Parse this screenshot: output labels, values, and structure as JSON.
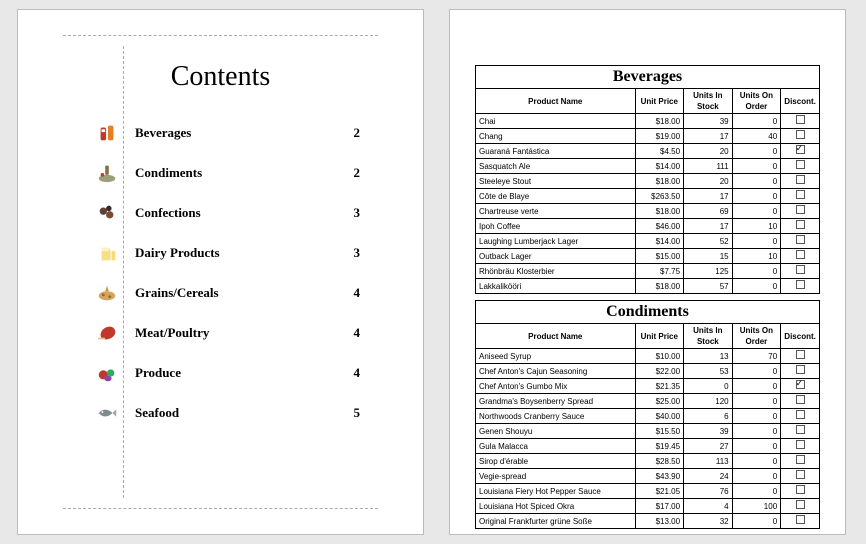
{
  "contents": {
    "title": "Contents",
    "items": [
      {
        "label": "Beverages",
        "page": "2",
        "icon": "beverages"
      },
      {
        "label": "Condiments",
        "page": "2",
        "icon": "condiments"
      },
      {
        "label": "Confections",
        "page": "3",
        "icon": "confections"
      },
      {
        "label": "Dairy Products",
        "page": "3",
        "icon": "dairy"
      },
      {
        "label": "Grains/Cereals",
        "page": "4",
        "icon": "grains"
      },
      {
        "label": "Meat/Poultry",
        "page": "4",
        "icon": "meat"
      },
      {
        "label": "Produce",
        "page": "4",
        "icon": "produce"
      },
      {
        "label": "Seafood",
        "page": "5",
        "icon": "seafood"
      }
    ]
  },
  "columns": {
    "name": "Product Name",
    "price": "Unit Price",
    "stock": "Units In Stock",
    "order": "Units On Order",
    "disc": "Discont."
  },
  "sections": [
    {
      "title": "Beverages",
      "rows": [
        {
          "name": "Chai",
          "price": "$18.00",
          "stock": "39",
          "order": "0",
          "disc": false
        },
        {
          "name": "Chang",
          "price": "$19.00",
          "stock": "17",
          "order": "40",
          "disc": false
        },
        {
          "name": "Guaraná Fantástica",
          "price": "$4.50",
          "stock": "20",
          "order": "0",
          "disc": true
        },
        {
          "name": "Sasquatch Ale",
          "price": "$14.00",
          "stock": "111",
          "order": "0",
          "disc": false
        },
        {
          "name": "Steeleye Stout",
          "price": "$18.00",
          "stock": "20",
          "order": "0",
          "disc": false
        },
        {
          "name": "Côte de Blaye",
          "price": "$263.50",
          "stock": "17",
          "order": "0",
          "disc": false
        },
        {
          "name": "Chartreuse verte",
          "price": "$18.00",
          "stock": "69",
          "order": "0",
          "disc": false
        },
        {
          "name": "Ipoh Coffee",
          "price": "$46.00",
          "stock": "17",
          "order": "10",
          "disc": false
        },
        {
          "name": "Laughing Lumberjack Lager",
          "price": "$14.00",
          "stock": "52",
          "order": "0",
          "disc": false
        },
        {
          "name": "Outback Lager",
          "price": "$15.00",
          "stock": "15",
          "order": "10",
          "disc": false
        },
        {
          "name": "Rhönbräu Klosterbier",
          "price": "$7.75",
          "stock": "125",
          "order": "0",
          "disc": false
        },
        {
          "name": "Lakkalikööri",
          "price": "$18.00",
          "stock": "57",
          "order": "0",
          "disc": false
        }
      ]
    },
    {
      "title": "Condiments",
      "rows": [
        {
          "name": "Aniseed Syrup",
          "price": "$10.00",
          "stock": "13",
          "order": "70",
          "disc": false
        },
        {
          "name": "Chef Anton's Cajun Seasoning",
          "price": "$22.00",
          "stock": "53",
          "order": "0",
          "disc": false
        },
        {
          "name": "Chef Anton's Gumbo Mix",
          "price": "$21.35",
          "stock": "0",
          "order": "0",
          "disc": true
        },
        {
          "name": "Grandma's Boysenberry Spread",
          "price": "$25.00",
          "stock": "120",
          "order": "0",
          "disc": false
        },
        {
          "name": "Northwoods Cranberry Sauce",
          "price": "$40.00",
          "stock": "6",
          "order": "0",
          "disc": false
        },
        {
          "name": "Genen Shouyu",
          "price": "$15.50",
          "stock": "39",
          "order": "0",
          "disc": false
        },
        {
          "name": "Gula Malacca",
          "price": "$19.45",
          "stock": "27",
          "order": "0",
          "disc": false
        },
        {
          "name": "Sirop d'érable",
          "price": "$28.50",
          "stock": "113",
          "order": "0",
          "disc": false
        },
        {
          "name": "Vegie-spread",
          "price": "$43.90",
          "stock": "24",
          "order": "0",
          "disc": false
        },
        {
          "name": "Louisiana Fiery Hot Pepper Sauce",
          "price": "$21.05",
          "stock": "76",
          "order": "0",
          "disc": false
        },
        {
          "name": "Louisiana Hot Spiced Okra",
          "price": "$17.00",
          "stock": "4",
          "order": "100",
          "disc": false
        },
        {
          "name": "Original Frankfurter grüne Soße",
          "price": "$13.00",
          "stock": "32",
          "order": "0",
          "disc": false
        }
      ]
    }
  ]
}
